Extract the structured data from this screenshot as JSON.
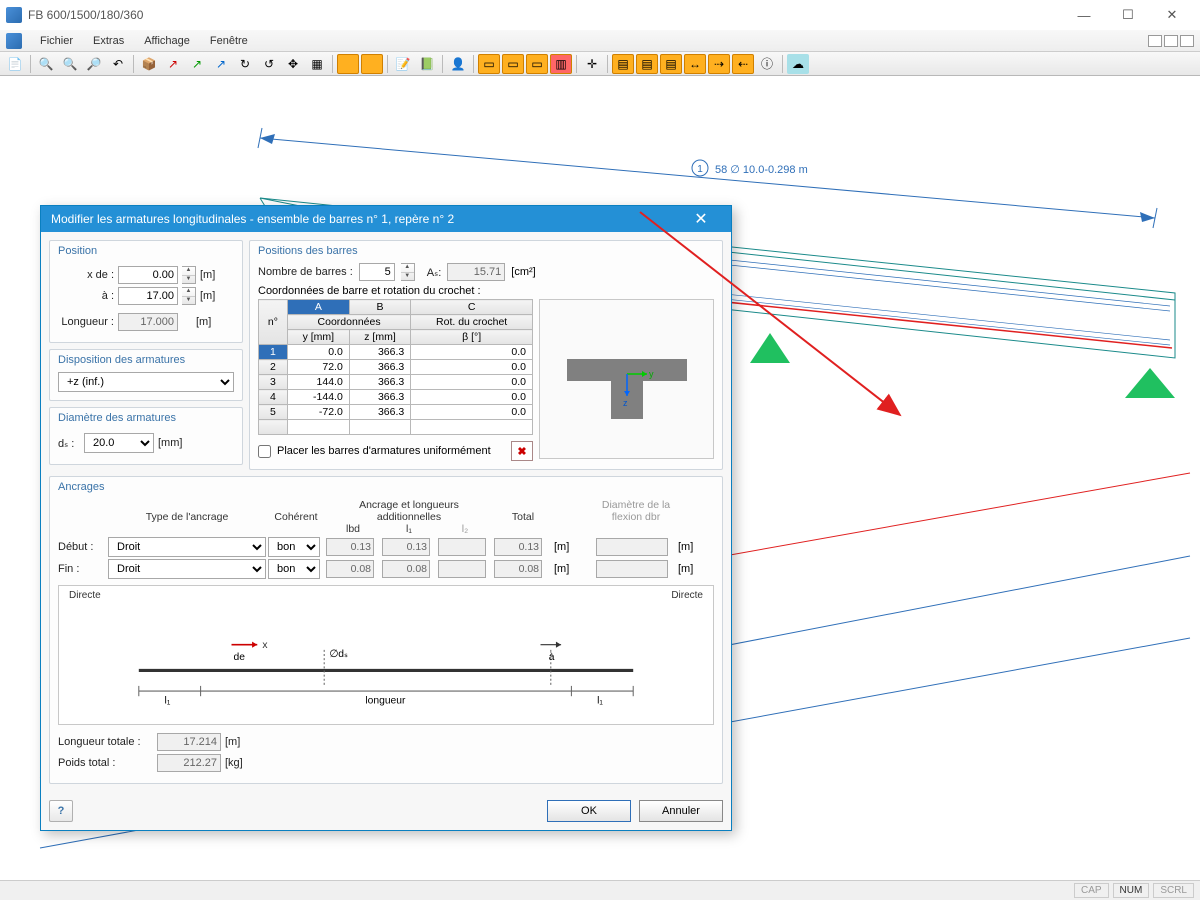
{
  "app": {
    "title": "FB 600/1500/180/360",
    "window_buttons": {
      "min": "—",
      "max": "☐",
      "close": "✕"
    }
  },
  "menu": [
    "Fichier",
    "Extras",
    "Affichage",
    "Fenêtre"
  ],
  "annotation": {
    "left": "1",
    "right": "58 ∅ 10.0-0.298 m"
  },
  "statusbar": {
    "cap": "CAP",
    "num": "NUM",
    "scrl": "SCRL"
  },
  "dialog": {
    "title": "Modifier les armatures longitudinales - ensemble de barres n° 1, repère n° 2",
    "position": {
      "title": "Position",
      "x_de": {
        "label": "x de :",
        "value": "0.00",
        "unit": "[m]"
      },
      "a": {
        "label": "à :",
        "value": "17.00",
        "unit": "[m]"
      },
      "longueur": {
        "label": "Longueur :",
        "value": "17.000",
        "unit": "[m]"
      }
    },
    "disposition": {
      "title": "Disposition des armatures",
      "value": "+z (inf.)"
    },
    "diametre": {
      "title": "Diamètre des armatures",
      "label": "dₛ :",
      "value": "20.0",
      "unit": "[mm]"
    },
    "barres": {
      "title": "Positions des barres",
      "nombre_label": "Nombre de barres :",
      "nombre": "5",
      "as_label": "Aₛ:",
      "as_value": "15.71",
      "as_unit": "[cm²]",
      "coord_label": "Coordonnées de barre et rotation du crochet :",
      "headers": {
        "n": "n°",
        "A": "A",
        "B": "B",
        "C": "C",
        "coord": "Coordonnées",
        "rot": "Rot. du crochet",
        "y": "y [mm]",
        "z": "z [mm]",
        "beta": "β [°]"
      },
      "rows": [
        {
          "n": "1",
          "y": "0.0",
          "z": "366.3",
          "b": "0.0"
        },
        {
          "n": "2",
          "y": "72.0",
          "z": "366.3",
          "b": "0.0"
        },
        {
          "n": "3",
          "y": "144.0",
          "z": "366.3",
          "b": "0.0"
        },
        {
          "n": "4",
          "y": "-144.0",
          "z": "366.3",
          "b": "0.0"
        },
        {
          "n": "5",
          "y": "-72.0",
          "z": "366.3",
          "b": "0.0"
        }
      ],
      "uniform_label": "Placer les barres d'armatures uniformément"
    },
    "ancrages": {
      "title": "Ancrages",
      "headers": {
        "type": "Type de l'ancrage",
        "coherent": "Cohérent",
        "addl": "Ancrage et longueurs additionnelles",
        "lbd": "lbd",
        "l1": "l₁",
        "l2": "l₂",
        "total": "Total",
        "diam": "Diamètre de la flexion dbr"
      },
      "debut": {
        "label": "Début :",
        "type": "Droit",
        "coherent": "bon",
        "lbd": "0.13",
        "l1": "0.13",
        "l2": "",
        "total": "0.13",
        "unit": "[m]",
        "dbr": "",
        "dbr_unit": "[m]"
      },
      "fin": {
        "label": "Fin :",
        "type": "Droit",
        "coherent": "bon",
        "lbd": "0.08",
        "l1": "0.08",
        "l2": "",
        "total": "0.08",
        "unit": "[m]",
        "dbr": "",
        "dbr_unit": "[m]"
      },
      "diagram": {
        "left": "Directe",
        "right": "Directe",
        "labels": {
          "de": "de",
          "a": "à",
          "l1": "l₁",
          "longueur": "longueur",
          "x": "x",
          "ds": "∅dₛ"
        }
      }
    },
    "totals": {
      "longueur": {
        "label": "Longueur totale :",
        "value": "17.214",
        "unit": "[m]"
      },
      "poids": {
        "label": "Poids total :",
        "value": "212.27",
        "unit": "[kg]"
      }
    },
    "buttons": {
      "ok": "OK",
      "cancel": "Annuler"
    }
  }
}
